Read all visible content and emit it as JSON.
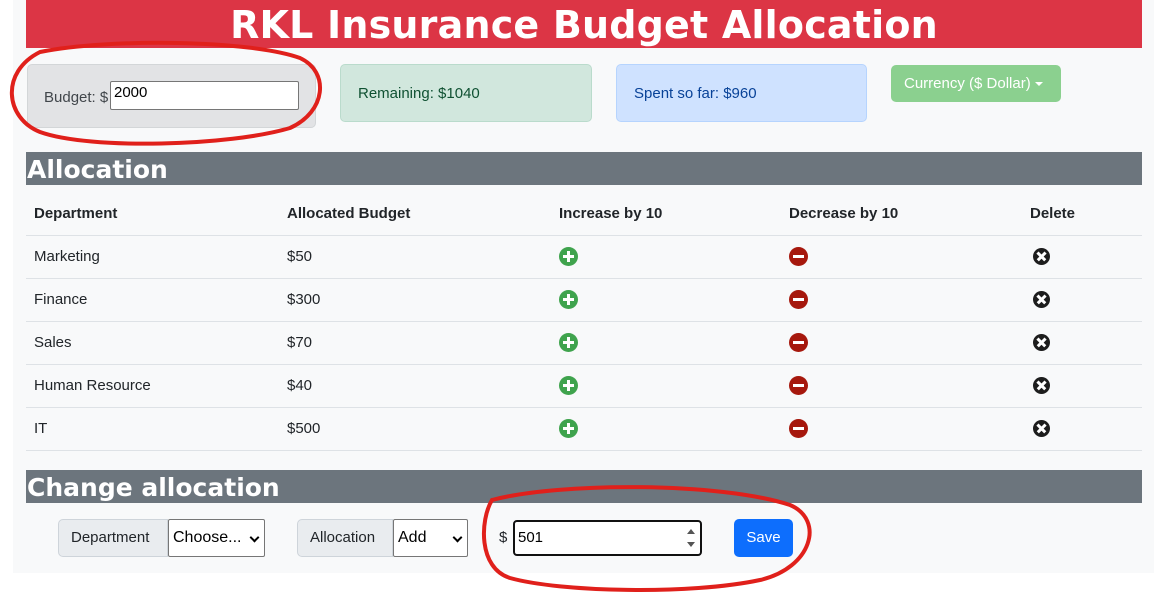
{
  "header": {
    "title": "RKL Insurance Budget Allocation"
  },
  "budget": {
    "label": "Budget: $",
    "value": "2000"
  },
  "remaining": {
    "text": "Remaining: $1040"
  },
  "spent": {
    "text": "Spent so far: $960"
  },
  "currency": {
    "label": "Currency ($ Dollar)"
  },
  "allocation": {
    "heading": "Allocation",
    "columns": [
      "Department",
      "Allocated Budget",
      "Increase by 10",
      "Decrease by 10",
      "Delete"
    ],
    "rows": [
      {
        "department": "Marketing",
        "budget": "$50"
      },
      {
        "department": "Finance",
        "budget": "$300"
      },
      {
        "department": "Sales",
        "budget": "$70"
      },
      {
        "department": "Human Resource",
        "budget": "$40"
      },
      {
        "department": "IT",
        "budget": "$500"
      }
    ]
  },
  "change": {
    "heading": "Change allocation",
    "department_label": "Department",
    "department_value": "Choose...",
    "allocation_label": "Allocation",
    "allocation_value": "Add",
    "currency_symbol": "$",
    "amount": "501",
    "save_label": "Save"
  },
  "colors": {
    "header": "#dc3545",
    "section": "#6c757d",
    "increase": "#3fa34d",
    "decrease": "#a6180d",
    "save": "#0d6efd",
    "annotation": "#e0201b"
  },
  "icons": {
    "increase": "plus-circle-icon",
    "decrease": "minus-circle-icon",
    "delete": "x-circle-icon"
  }
}
